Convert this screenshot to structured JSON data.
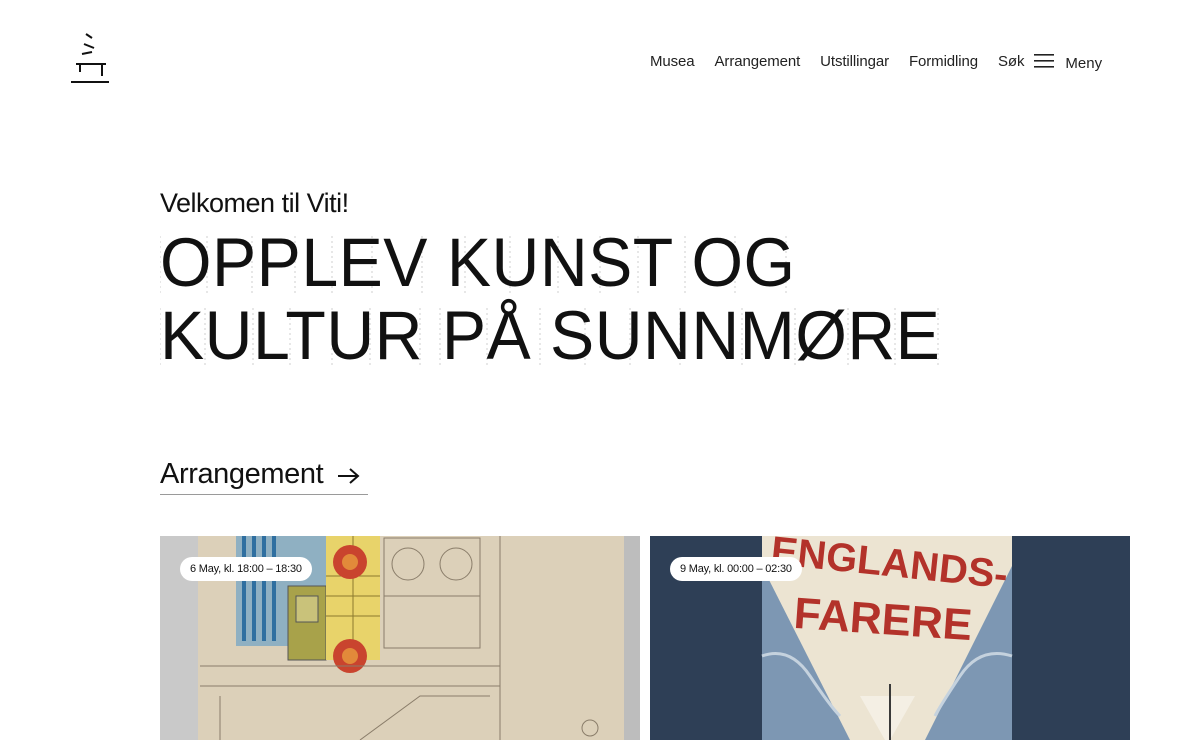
{
  "header": {
    "logo_icon": "viti-logo-icon",
    "nav": [
      {
        "label": "Musea"
      },
      {
        "label": "Arrangement"
      },
      {
        "label": "Utstillingar"
      },
      {
        "label": "Formidling"
      },
      {
        "label": "Søk"
      }
    ],
    "menu": {
      "label": "Meny",
      "icon": "hamburger-icon"
    }
  },
  "hero": {
    "welcome": "Velkomen til Viti!",
    "headline_line1": "OPPLEV KUNST OG",
    "headline_line2": "KULTUR PÅ SUNNMØRE"
  },
  "events_link": {
    "label": "Arrangement",
    "icon": "arrow-right-icon"
  },
  "cards": [
    {
      "date": "6 May, kl. 18:00 – 18:30",
      "image": "architectural-drawing-image"
    },
    {
      "date": "9 May, kl. 00:00 – 02:30",
      "image": "englandsfarere-poster-image",
      "poster_text_1": "ENGLANDS-",
      "poster_text_2": "FARERE"
    }
  ],
  "colors": {
    "text": "#111111",
    "card2_bg": "#2e3f56",
    "poster_red": "#b3322a"
  }
}
